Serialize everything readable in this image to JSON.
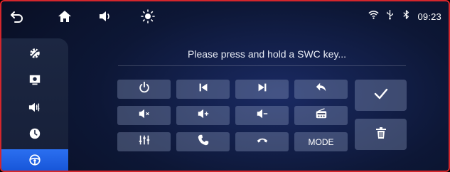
{
  "status_bar": {
    "back_icon": "back-arrow-icon",
    "home_icon": "home-icon",
    "volume_icon": "volume-icon",
    "brightness_icon": "brightness-icon",
    "wifi_icon": "wifi-icon",
    "usb_icon": "usb-icon",
    "bluetooth_icon": "bluetooth-icon",
    "time": "09:23"
  },
  "sidebar": {
    "items": [
      {
        "icon": "gear-icon",
        "active": false
      },
      {
        "icon": "display-settings-icon",
        "active": false
      },
      {
        "icon": "sound-settings-icon",
        "active": false
      },
      {
        "icon": "clock-icon",
        "active": false
      },
      {
        "icon": "steering-wheel-icon",
        "active": true
      }
    ]
  },
  "main": {
    "prompt": "Please press and hold a SWC key...",
    "keys_row1": [
      "power-icon",
      "previous-track-icon",
      "next-track-icon",
      "return-icon"
    ],
    "keys_row2": [
      "mute-icon",
      "volume-up-icon",
      "volume-down-icon",
      "radio-icon"
    ],
    "keys_row3": [
      "equalizer-icon",
      "phone-answer-icon",
      "phone-hangup-icon"
    ],
    "mode_label": "MODE",
    "confirm_icon": "checkmark-icon",
    "delete_icon": "trash-icon"
  },
  "colors": {
    "frame_border": "#d4262c",
    "active_sidebar": "#2b6ff0",
    "key_bg": "#5d6680"
  }
}
